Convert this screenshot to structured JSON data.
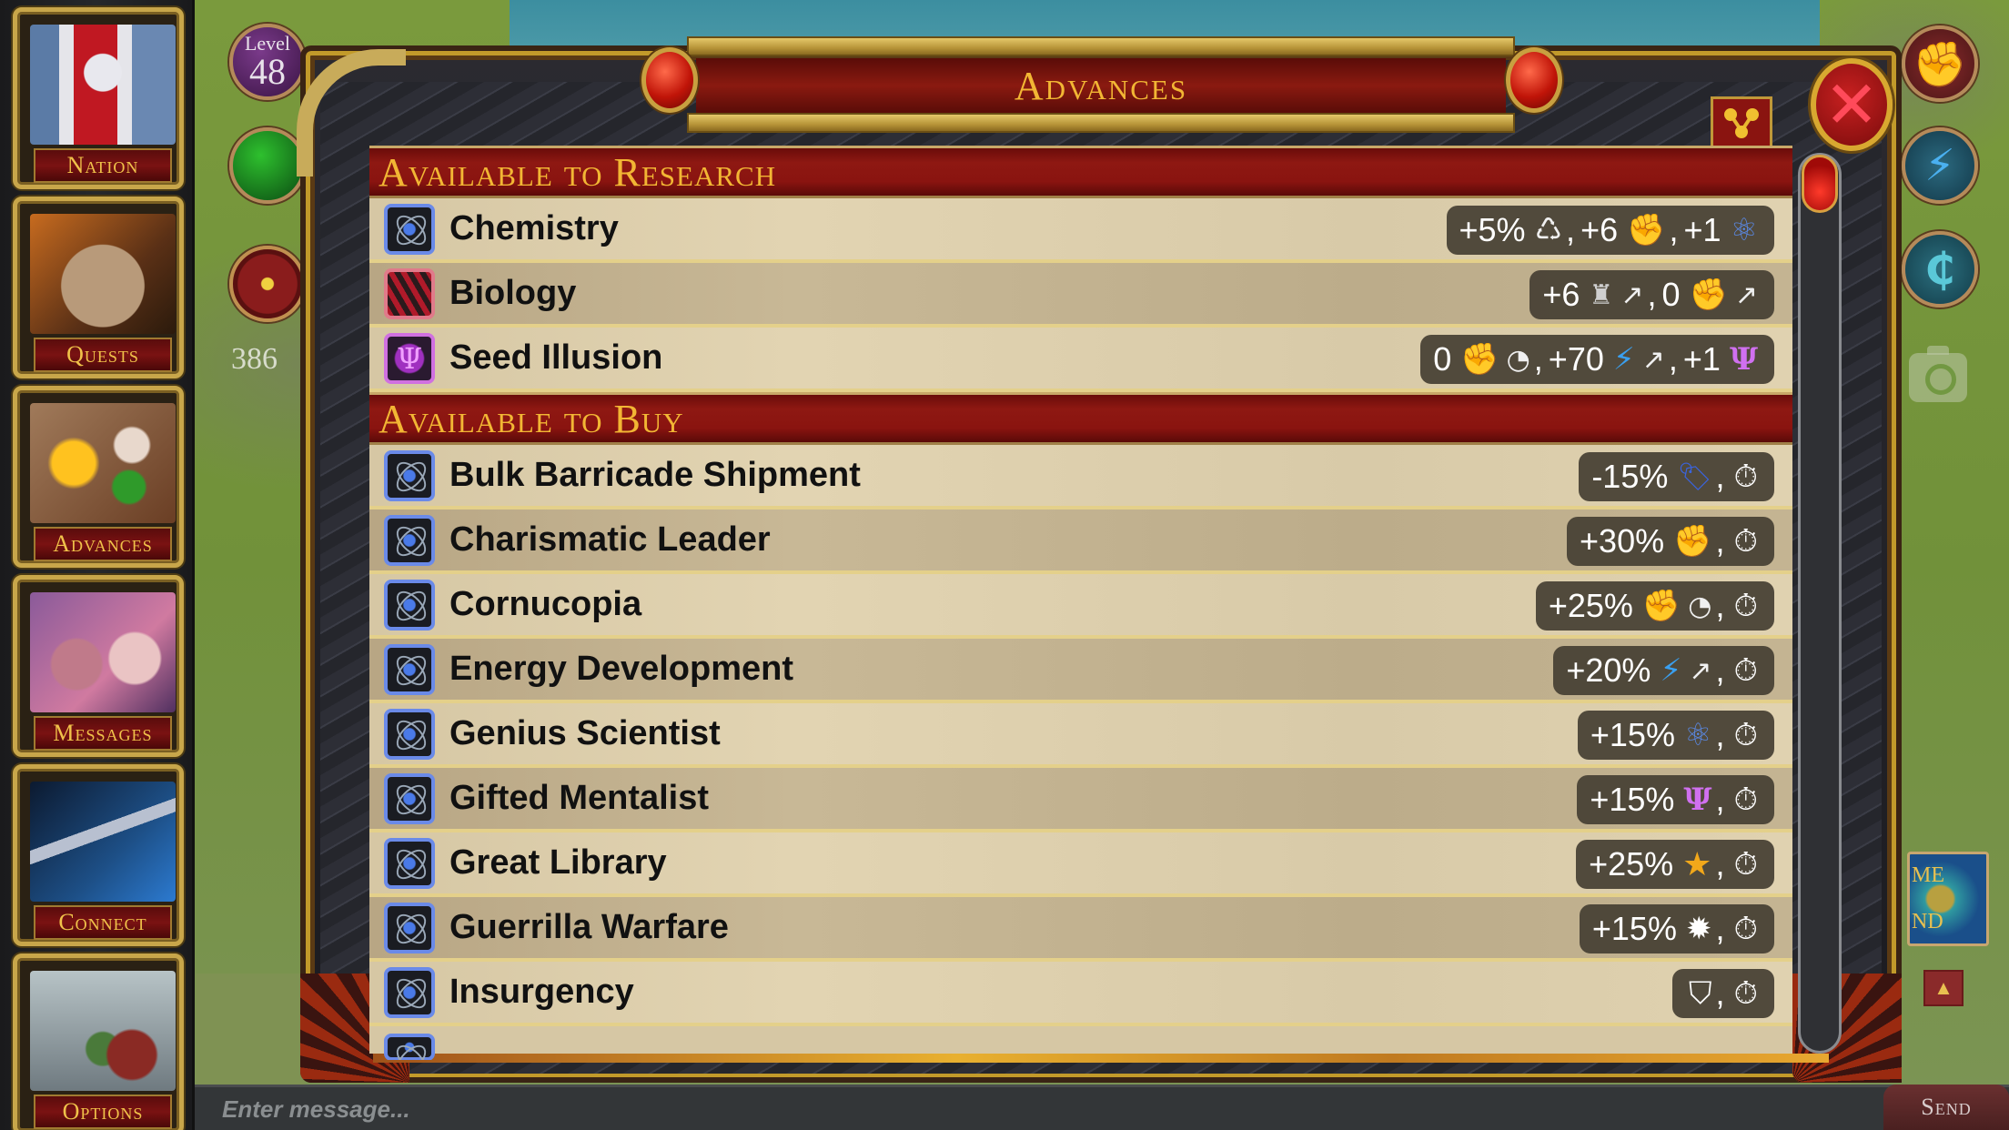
{
  "sidebar": {
    "items": [
      {
        "label": "Nation",
        "icon": "nation-pillars-icon"
      },
      {
        "label": "Quests",
        "icon": "quests-map-icon"
      },
      {
        "label": "Advances",
        "icon": "advances-alchemy-icon"
      },
      {
        "label": "Messages",
        "icon": "messages-faces-icon"
      },
      {
        "label": "Connect",
        "icon": "connect-satellite-icon"
      },
      {
        "label": "Options",
        "icon": "options-cockpit-icon"
      }
    ]
  },
  "hud": {
    "level_label": "Level",
    "level_value": "48",
    "count_value": "386",
    "home_island_label_top": "ME",
    "home_island_label_bottom": "ND"
  },
  "dialog": {
    "title": "Advances",
    "sections": [
      {
        "title": "Available to Research",
        "rows": [
          {
            "name": "Chemistry",
            "icon": "atom",
            "effects": [
              {
                "value": "+5%",
                "icons": [
                  "recycle"
                ]
              },
              {
                "value": "+6",
                "icons": [
                  "fist-double"
                ]
              },
              {
                "value": "+1",
                "icons": [
                  "atom"
                ]
              }
            ]
          },
          {
            "name": "Biology",
            "icon": "dna",
            "effects": [
              {
                "value": "+6",
                "icons": [
                  "tower",
                  "trend-up"
                ]
              },
              {
                "value": "0",
                "icons": [
                  "fist",
                  "trend-up"
                ]
              }
            ]
          },
          {
            "name": "Seed Illusion",
            "icon": "psi",
            "effects": [
              {
                "value": "0",
                "icons": [
                  "fist",
                  "gauge"
                ]
              },
              {
                "value": "+70",
                "icons": [
                  "bolt",
                  "trend-up"
                ]
              },
              {
                "value": "+1",
                "icons": [
                  "psi"
                ]
              }
            ]
          }
        ]
      },
      {
        "title": "Available to Buy",
        "rows": [
          {
            "name": "Bulk Barricade Shipment",
            "icon": "atom",
            "effects": [
              {
                "value": "-15%",
                "icons": [
                  "price-tag"
                ]
              },
              {
                "value": "",
                "icons": [
                  "timer"
                ]
              }
            ]
          },
          {
            "name": "Charismatic Leader",
            "icon": "atom",
            "effects": [
              {
                "value": "+30%",
                "icons": [
                  "fist-double"
                ]
              },
              {
                "value": "",
                "icons": [
                  "timer"
                ]
              }
            ]
          },
          {
            "name": "Cornucopia",
            "icon": "atom",
            "effects": [
              {
                "value": "+25%",
                "icons": [
                  "fist",
                  "gauge"
                ]
              },
              {
                "value": "",
                "icons": [
                  "timer"
                ]
              }
            ]
          },
          {
            "name": "Energy Development",
            "icon": "atom",
            "effects": [
              {
                "value": "+20%",
                "icons": [
                  "bolt",
                  "trend-up"
                ]
              },
              {
                "value": "",
                "icons": [
                  "timer"
                ]
              }
            ]
          },
          {
            "name": "Genius Scientist",
            "icon": "atom",
            "effects": [
              {
                "value": "+15%",
                "icons": [
                  "atom"
                ]
              },
              {
                "value": "",
                "icons": [
                  "timer"
                ]
              }
            ]
          },
          {
            "name": "Gifted Mentalist",
            "icon": "atom",
            "effects": [
              {
                "value": "+15%",
                "icons": [
                  "psi"
                ]
              },
              {
                "value": "",
                "icons": [
                  "timer"
                ]
              }
            ]
          },
          {
            "name": "Great Library",
            "icon": "atom",
            "effects": [
              {
                "value": "+25%",
                "icons": [
                  "star"
                ]
              },
              {
                "value": "",
                "icons": [
                  "timer"
                ]
              }
            ]
          },
          {
            "name": "Guerrilla Warfare",
            "icon": "atom",
            "effects": [
              {
                "value": "+15%",
                "icons": [
                  "burst"
                ]
              },
              {
                "value": "",
                "icons": [
                  "timer"
                ]
              }
            ]
          },
          {
            "name": "Insurgency",
            "icon": "atom",
            "effects": [
              {
                "value": "",
                "icons": [
                  "shield"
                ]
              },
              {
                "value": "",
                "icons": [
                  "timer"
                ]
              }
            ]
          }
        ]
      }
    ]
  },
  "icon_glyphs": {
    "recycle": "♺",
    "fist": "✊",
    "fist-double": "✊",
    "atom": "⚛",
    "tower": "♜",
    "trend-up": "↗",
    "gauge": "◔",
    "bolt": "⚡",
    "psi": "Ψ",
    "price-tag": "🏷",
    "timer": "⏱",
    "star": "★",
    "burst": "✹",
    "shield": "⛉"
  },
  "chat": {
    "placeholder": "Enter message...",
    "send_label": "Send"
  },
  "colors": {
    "title_gold": "#f2b634",
    "header_red": "#8a1410",
    "row_parchment": "#e2d4b2",
    "pill_bg": "#464034"
  }
}
